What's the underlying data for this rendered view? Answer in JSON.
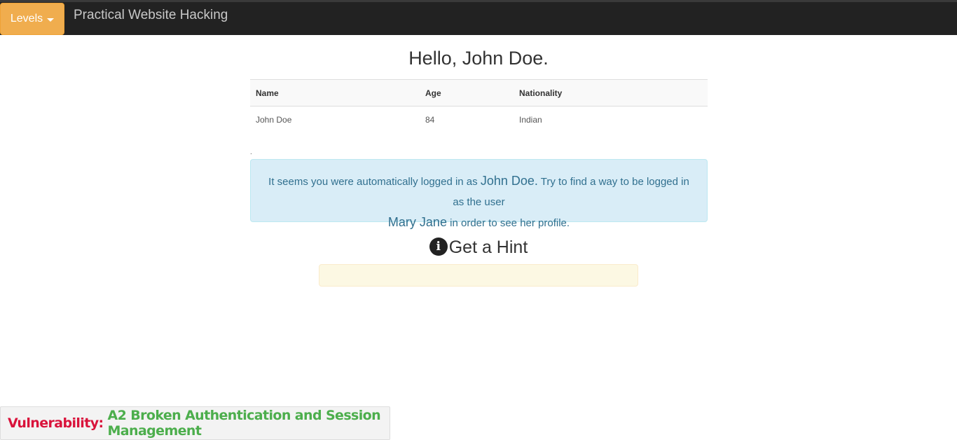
{
  "navbar": {
    "levels_label": "Levels",
    "brand": "Practical Website Hacking"
  },
  "greeting": "Hello, John Doe.",
  "table": {
    "headers": [
      "Name",
      "Age",
      "Nationality"
    ],
    "rows": [
      [
        "John Doe",
        "84",
        "Indian"
      ]
    ]
  },
  "dot": ".",
  "info": {
    "part1": "It seems you were automatically logged in as ",
    "name1": "John Doe.",
    "part2": " Try to find a way to be logged in as the user",
    "name2": "Mary Jane",
    "part3": " in order to see her profile."
  },
  "hint": {
    "icon": "info-circle-icon",
    "title": "Get a Hint"
  },
  "vulnerability": {
    "label": "Vulnerability:",
    "value": "A2 Broken Authentication and Session Management"
  },
  "colors": {
    "navbar": "#222222",
    "levels_button": "#f0ad4e",
    "info_bg": "#d9edf7",
    "hint_bg": "#fcf8e3",
    "vuln_label": "#d9133b",
    "vuln_value": "#4cae4c"
  }
}
